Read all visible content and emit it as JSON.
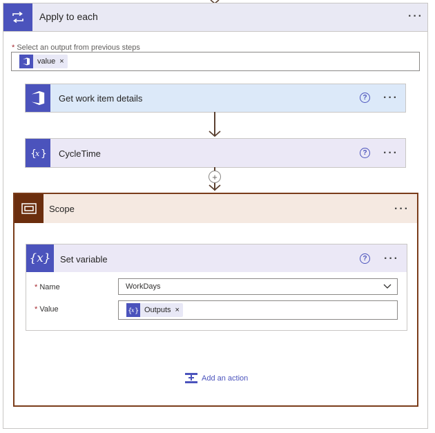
{
  "apply_to_each": {
    "title": "Apply to each",
    "select_label": "Select an output from previous steps",
    "required_mark": "*",
    "token": {
      "label": "value",
      "close": "×",
      "icon": "devops-icon"
    }
  },
  "steps": [
    {
      "title": "Get work item details",
      "icon": "devops-icon",
      "help": "?"
    },
    {
      "title": "CycleTime",
      "icon": "expression-icon",
      "help": "?"
    }
  ],
  "scope": {
    "title": "Scope",
    "set_variable": {
      "title": "Set variable",
      "icon_text": "{x}",
      "help": "?",
      "name_label": "Name",
      "name_value": "WorkDays",
      "value_label": "Value",
      "value_token": {
        "label": "Outputs",
        "close": "×",
        "icon": "expression-icon"
      }
    },
    "add_action": "Add an action"
  },
  "more_label": "···",
  "colors": {
    "accent": "#4b53bc",
    "scope_brown": "#6b2e0e",
    "scope_border": "#7a3c1a",
    "arrow": "#5a4030",
    "devops_header_bg": "#dce9f9"
  }
}
